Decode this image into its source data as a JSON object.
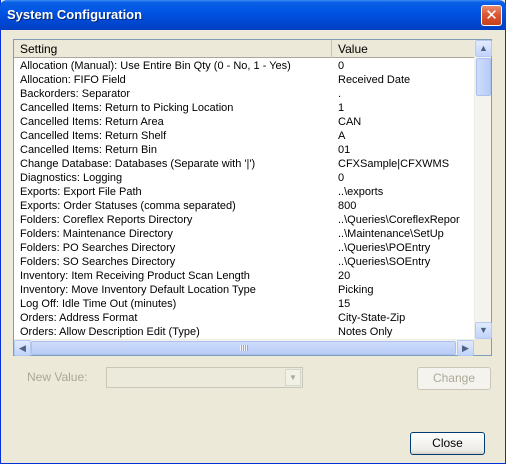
{
  "window": {
    "title": "System Configuration",
    "close_glyph": "✕"
  },
  "list": {
    "headers": {
      "setting": "Setting",
      "value": "Value"
    },
    "rows": [
      {
        "setting": "Allocation (Manual): Use Entire Bin Qty (0 - No, 1 - Yes)",
        "value": "0"
      },
      {
        "setting": "Allocation: FIFO Field",
        "value": "Received Date"
      },
      {
        "setting": "Backorders: Separator",
        "value": "."
      },
      {
        "setting": "Cancelled Items: Return to Picking Location",
        "value": "1"
      },
      {
        "setting": "Cancelled Items: Return Area",
        "value": "CAN"
      },
      {
        "setting": "Cancelled Items: Return Shelf",
        "value": "A"
      },
      {
        "setting": "Cancelled Items: Return Bin",
        "value": "01"
      },
      {
        "setting": "Change Database: Databases (Separate with '|')",
        "value": "CFXSample|CFXWMS"
      },
      {
        "setting": "Diagnostics: Logging",
        "value": "0"
      },
      {
        "setting": "Exports: Export File Path",
        "value": "..\\exports"
      },
      {
        "setting": "Exports: Order Statuses (comma separated)",
        "value": "800"
      },
      {
        "setting": "Folders: Coreflex Reports Directory",
        "value": "..\\Queries\\CoreflexRepor"
      },
      {
        "setting": "Folders: Maintenance Directory",
        "value": "..\\Maintenance\\SetUp"
      },
      {
        "setting": "Folders: PO Searches Directory",
        "value": "..\\Queries\\POEntry"
      },
      {
        "setting": "Folders: SO Searches Directory",
        "value": "..\\Queries\\SOEntry"
      },
      {
        "setting": "Inventory: Item Receiving Product Scan Length",
        "value": "20"
      },
      {
        "setting": "Inventory: Move Inventory Default Location Type",
        "value": "Picking"
      },
      {
        "setting": "Log Off: Idle Time Out (minutes)",
        "value": "15"
      },
      {
        "setting": "Orders: Address Format",
        "value": "City-State-Zip"
      },
      {
        "setting": "Orders: Allow Description Edit (Type)",
        "value": "Notes Only"
      }
    ],
    "scroll_up_glyph": "▲",
    "scroll_down_glyph": "▼",
    "scroll_left_glyph": "◀",
    "scroll_right_glyph": "▶"
  },
  "new_value": {
    "label": "New Value:",
    "value": "",
    "arrow_glyph": "▼"
  },
  "buttons": {
    "change": "Change",
    "close": "Close"
  },
  "colors": {
    "titlebar": "#0054e3",
    "dialog_bg": "#ece9d8",
    "disabled_text": "#aca899"
  }
}
